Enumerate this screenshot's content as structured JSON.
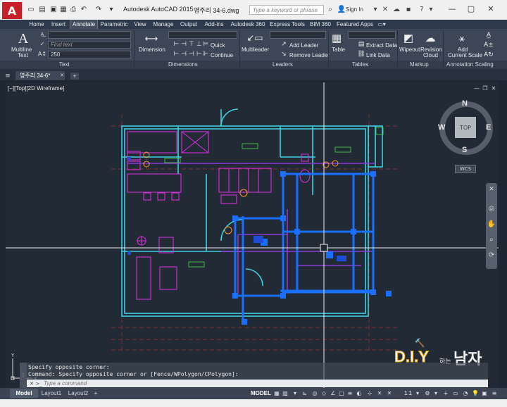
{
  "title_bar": {
    "app_title": "Autodesk AutoCAD 2015",
    "file_name": "영주리 34-6.dwg",
    "search_placeholder": "Type a keyword or phrase",
    "sign_in": "Sign In"
  },
  "ribbon_tabs": [
    {
      "label": "Home"
    },
    {
      "label": "Insert"
    },
    {
      "label": "Annotate",
      "active": true
    },
    {
      "label": "Parametric"
    },
    {
      "label": "View"
    },
    {
      "label": "Manage"
    },
    {
      "label": "Output"
    },
    {
      "label": "Add-ins"
    },
    {
      "label": "Autodesk 360"
    },
    {
      "label": "Express Tools"
    },
    {
      "label": "BIM 360"
    },
    {
      "label": "Featured Apps"
    }
  ],
  "ribbon": {
    "text_panel": {
      "multiline_text": "Multiline",
      "multiline_text2": "Text",
      "find_text_placeholder": "Find text",
      "text_height": "250",
      "label": "Text"
    },
    "dimensions_panel": {
      "dimension": "Dimension",
      "quick": "Quick",
      "continue": "Continue",
      "label": "Dimensions"
    },
    "leaders_panel": {
      "multileader": "Multileader",
      "add_leader": "Add Leader",
      "remove_leader": "Remove Leader",
      "label": "Leaders"
    },
    "tables_panel": {
      "table": "Table",
      "extract_data": "Extract Data",
      "link_data": "Link Data",
      "label": "Tables"
    },
    "markup_panel": {
      "wipeout": "Wipeout",
      "revision_cloud": "Revision",
      "revision_cloud2": "Cloud",
      "label": "Markup"
    },
    "annotation_scaling_panel": {
      "add_current_scale": "Add",
      "add_current_scale2": "Current Scale",
      "label": "Annotation Scaling"
    }
  },
  "document_tabs": [
    {
      "label": "영주리 34-6*",
      "active": true
    }
  ],
  "viewport": {
    "label": "[−][Top][2D Wireframe]",
    "viewcube": {
      "north": "N",
      "south": "S",
      "east": "E",
      "west": "W",
      "face": "TOP",
      "ucs": "WCS"
    }
  },
  "command_line": {
    "history": [
      "Specify opposite corner:",
      "Command: Specify opposite corner or [Fence/WPolygon/CPolygon]:"
    ],
    "input_placeholder": "Type a command"
  },
  "layout_tabs": [
    {
      "label": "Model",
      "active": true
    },
    {
      "label": "Layout1"
    },
    {
      "label": "Layout2"
    }
  ],
  "status_bar": {
    "model_label": "MODEL",
    "scale": "1:1"
  },
  "watermark": {
    "text": "D.I.Y",
    "sub": "하는",
    "main": "남자"
  },
  "colors": {
    "drawing_background": "#222a36",
    "wall_cyan": "#3fd0e0",
    "furniture_magenta": "#d030d8",
    "selection_blue": "#1b6fff",
    "autocad_red": "#c8202a"
  }
}
